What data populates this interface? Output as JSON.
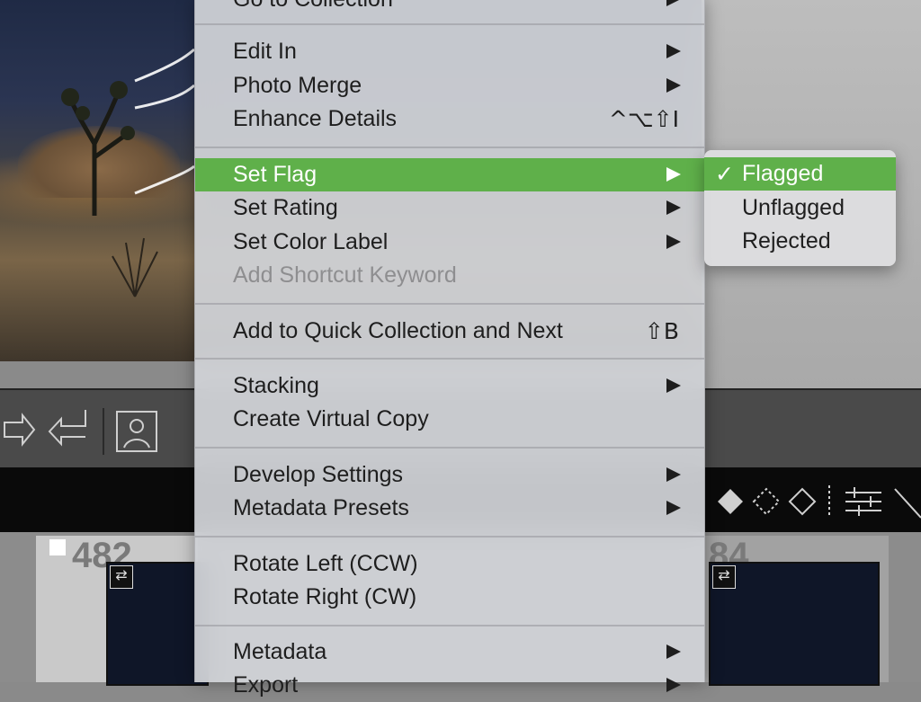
{
  "menu": {
    "items": [
      {
        "label": "Go to Collection",
        "arrow": true
      },
      {
        "label": "Edit In",
        "arrow": true
      },
      {
        "label": "Photo Merge",
        "arrow": true
      },
      {
        "label": "Enhance Details",
        "shortcut": "^⌥⇧I"
      },
      {
        "label": "Set Flag",
        "arrow": true,
        "highlighted": true
      },
      {
        "label": "Set Rating",
        "arrow": true
      },
      {
        "label": "Set Color Label",
        "arrow": true
      },
      {
        "label": "Add Shortcut Keyword",
        "disabled": true
      },
      {
        "label": "Add to Quick Collection and Next",
        "shortcut": "⇧B"
      },
      {
        "label": "Stacking",
        "arrow": true
      },
      {
        "label": "Create Virtual Copy"
      },
      {
        "label": "Develop Settings",
        "arrow": true
      },
      {
        "label": "Metadata Presets",
        "arrow": true
      },
      {
        "label": "Rotate Left (CCW)"
      },
      {
        "label": "Rotate Right (CW)"
      },
      {
        "label": "Metadata",
        "arrow": true
      },
      {
        "label": "Export",
        "arrow": true
      }
    ]
  },
  "submenu": {
    "items": [
      {
        "label": "Flagged",
        "checked": true,
        "check": "✓"
      },
      {
        "label": "Unflagged"
      },
      {
        "label": "Rejected"
      }
    ]
  },
  "filmstrip": {
    "left_number": "482",
    "right_number": "84"
  },
  "colors": {
    "highlight": "#5fb04a",
    "menu_bg": "#d2d4d8"
  }
}
